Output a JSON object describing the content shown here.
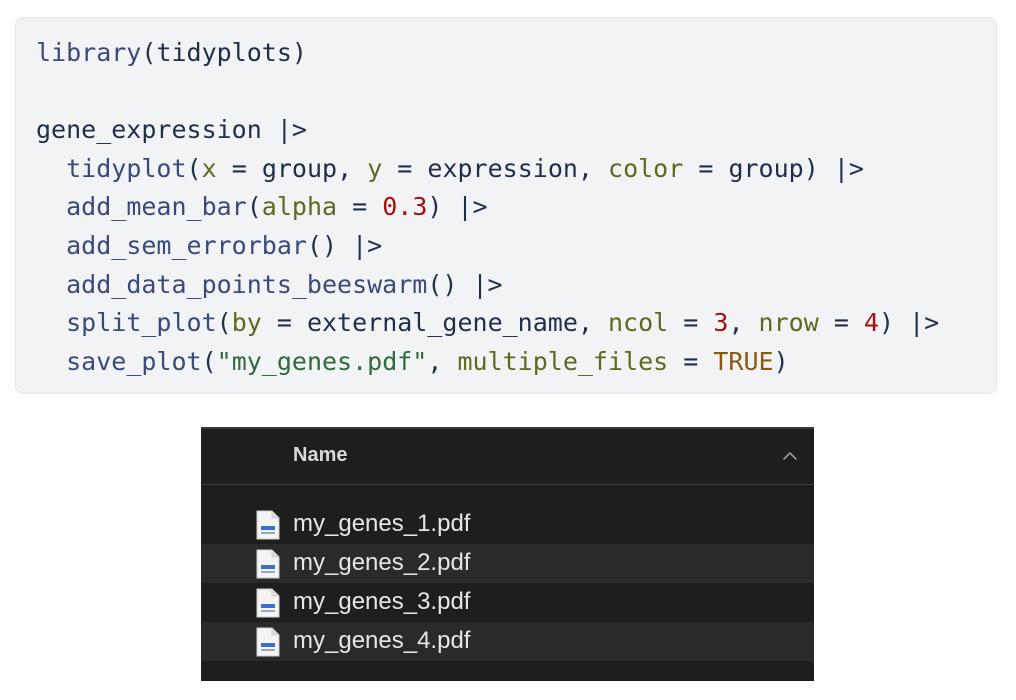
{
  "code": {
    "line1": {
      "fn": "library",
      "open": "(",
      "arg": "tidyplots",
      "close": ")"
    },
    "line3": {
      "text": "gene_expression",
      "pipe": "|>"
    },
    "line4": {
      "fn": "tidyplot",
      "open": "(",
      "a1": "x",
      "eq1": " = ",
      "v1": "group",
      "sep1": ", ",
      "a2": "y",
      "eq2": " = ",
      "v2": "expression",
      "sep2": ", ",
      "a3": "color",
      "eq3": " = ",
      "v3": "group",
      "close": ")",
      "pipe": " |>"
    },
    "line5": {
      "fn": "add_mean_bar",
      "open": "(",
      "a1": "alpha",
      "eq1": " = ",
      "n1": "0.3",
      "close": ")",
      "pipe": " |>"
    },
    "line6": {
      "fn": "add_sem_errorbar",
      "call": "()",
      "pipe": " |>"
    },
    "line7": {
      "fn": "add_data_points_beeswarm",
      "call": "()",
      "pipe": " |>"
    },
    "line8": {
      "fn": "split_plot",
      "open": "(",
      "a1": "by",
      "eq1": " = ",
      "v1": "external_gene_name",
      "sep1": ", ",
      "a2": "ncol",
      "eq2": " = ",
      "n2": "3",
      "sep2": ", ",
      "a3": "nrow",
      "eq3": " = ",
      "n3": "4",
      "close": ")",
      "pipe": " |>"
    },
    "line9": {
      "fn": "save_plot",
      "open": "(",
      "s1": "\"my_genes.pdf\"",
      "sep1": ", ",
      "a2": "multiple_files",
      "eq2": " = ",
      "k2": "TRUE",
      "close": ")"
    }
  },
  "finder": {
    "header_label": "Name",
    "sort_icon": "chevron-up-icon",
    "files": [
      {
        "name": "my_genes_1.pdf",
        "icon": "pdf-file-icon"
      },
      {
        "name": "my_genes_2.pdf",
        "icon": "pdf-file-icon"
      },
      {
        "name": "my_genes_3.pdf",
        "icon": "pdf-file-icon"
      },
      {
        "name": "my_genes_4.pdf",
        "icon": "pdf-file-icon"
      }
    ]
  },
  "colors": {
    "code_bg": "#f1f3f5",
    "function": "#3a4a7a",
    "argument": "#5e6a1e",
    "number": "#a3120f",
    "string": "#2f6a3a",
    "keyword": "#8a5a12",
    "finder_bg": "#1e1e1e",
    "finder_row_alt": "#2a2a2a"
  }
}
